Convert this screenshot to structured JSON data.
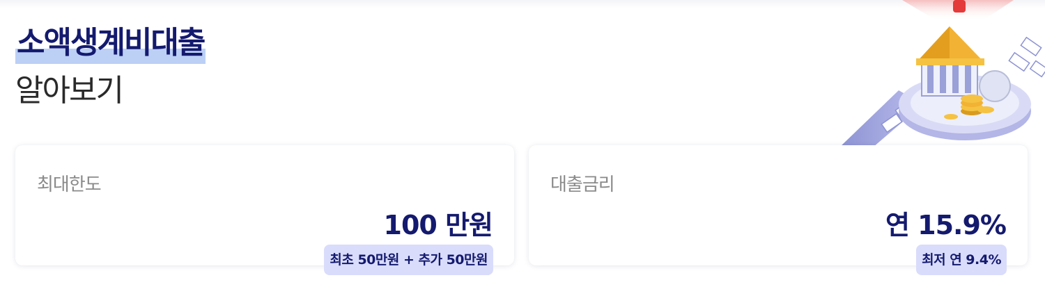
{
  "title": {
    "main": "소액생계비대출",
    "sub": "알아보기"
  },
  "illustration": {
    "icon": "bank-coins-illustration",
    "colors": {
      "bank_roof": "#f2b234",
      "coins": "#f5c242",
      "platform": "#c7c9ef",
      "belt": "#9aa0d8",
      "alarm": "#e43a3a"
    }
  },
  "cards": [
    {
      "label": "최대한도",
      "value": "100 만원",
      "badge": "최초 50만원 + 추가 50만원"
    },
    {
      "label": "대출금리",
      "value": "연 15.9%",
      "badge": "최저 연 9.4%"
    }
  ],
  "colors": {
    "navy": "#141a6e",
    "highlight": "#bcd0f6",
    "badge_bg": "#d9dcfb",
    "label_gray": "#8a8a8a"
  }
}
